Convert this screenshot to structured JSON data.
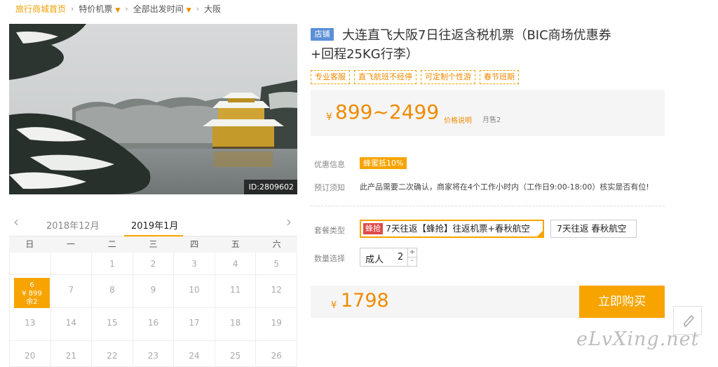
{
  "breadcrumb": {
    "home": "旅行商城首页",
    "level1": "特价机票",
    "level2": "全部出发时间",
    "level3": "大阪"
  },
  "photo": {
    "id_label": "ID:2809602"
  },
  "calendar": {
    "prev_month": "2018年12月",
    "current_month": "2019年1月",
    "weekdays": [
      "日",
      "一",
      "二",
      "三",
      "四",
      "五",
      "六"
    ],
    "days_row1": [
      "1",
      "2",
      "3",
      "4",
      "5"
    ],
    "days_row2": [
      "7",
      "8",
      "9",
      "10",
      "11",
      "12"
    ],
    "days_row3": [
      "13",
      "14",
      "15",
      "16",
      "17",
      "18",
      "19"
    ],
    "days_row4": [
      "20",
      "21",
      "22",
      "23",
      "24",
      "25",
      "26"
    ],
    "selected": {
      "day": "6",
      "price": "¥ 899",
      "remain": "余2"
    }
  },
  "product": {
    "store_tag": "店铺",
    "title_line1": "大连直飞大阪7日往返含税机票（BIC商场优惠券",
    "title_line2": "+回程25KG行李）",
    "tags": [
      "专业客服",
      "直飞航班不经停",
      "可定制个性游",
      "春节班期"
    ]
  },
  "price": {
    "currency": "¥",
    "range": "899~2499",
    "note": "价格说明",
    "sold": "月售2"
  },
  "promo": {
    "label": "优惠信息",
    "tag": "蜂蜜抵10%"
  },
  "booking_notice": {
    "label": "预订须知",
    "text": "此产品需要二次确认，商家将在4个工作小时内（工作日9:00-18:00）核实是否有位!"
  },
  "package": {
    "label": "套餐类型",
    "active_badge": "蜂抢",
    "active_text": "7天往返【蜂抢】往返机票+春秋航空",
    "other_text": "7天往返 春秋航空"
  },
  "quantity": {
    "label": "数量选择",
    "type": "成人",
    "value": "2",
    "plus": "+",
    "minus": "-"
  },
  "total": {
    "currency": "¥",
    "amount": "1798"
  },
  "buy_button": "立即购买",
  "float_icon": "pencil-icon",
  "watermark": "eLvXing.net",
  "colors": {
    "accent": "#f7a400",
    "price": "#f08a00",
    "store_tag": "#5b8fd6",
    "badge": "#e04a4a"
  }
}
